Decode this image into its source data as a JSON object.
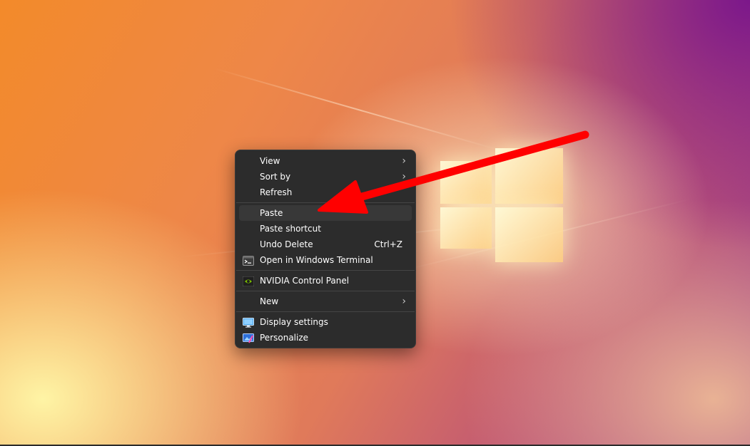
{
  "context_menu": {
    "items": [
      {
        "label": "View",
        "has_submenu": true
      },
      {
        "label": "Sort by",
        "has_submenu": true
      },
      {
        "label": "Refresh"
      },
      {
        "label": "Paste"
      },
      {
        "label": "Paste shortcut"
      },
      {
        "label": "Undo Delete",
        "shortcut": "Ctrl+Z"
      },
      {
        "label": "Open in Windows Terminal",
        "icon": "terminal-icon"
      },
      {
        "label": "NVIDIA Control Panel",
        "icon": "nvidia-icon"
      },
      {
        "label": "New",
        "has_submenu": true
      },
      {
        "label": "Display settings",
        "icon": "display-icon"
      },
      {
        "label": "Personalize",
        "icon": "personalize-icon"
      }
    ],
    "chevron": "›",
    "highlighted_item": "Paste"
  },
  "colors": {
    "menu_background": "#2c2c2c",
    "menu_hover": "#383838",
    "annotation_arrow": "#ff0000"
  }
}
